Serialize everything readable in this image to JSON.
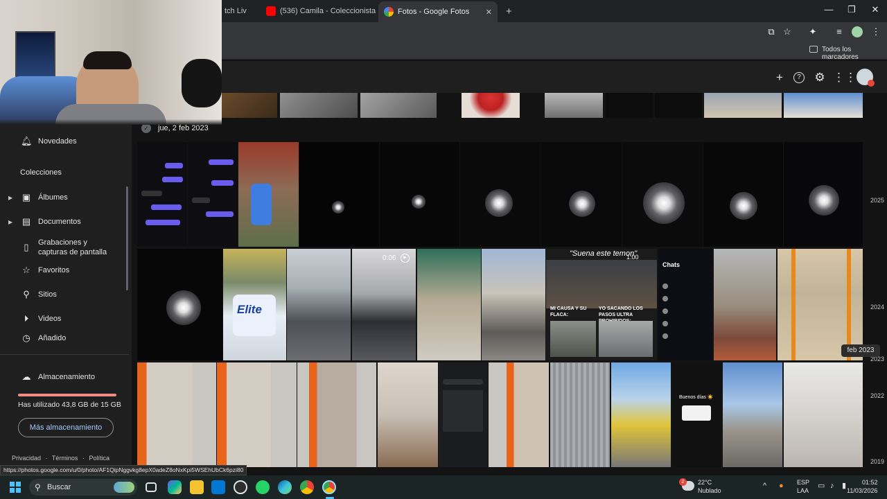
{
  "browser": {
    "tabs": [
      {
        "label": "tch Liv"
      },
      {
        "label": "(536) Camila - Coleccionista"
      },
      {
        "label": "Fotos - Google Fotos"
      }
    ],
    "new_tab_glyph": "+",
    "bookmarks_label": "Todos los marcadores"
  },
  "sidebar": {
    "items_top": [
      {
        "label": "Novedades",
        "icon": "bell-icon"
      }
    ],
    "collections_label": "Colecciones",
    "items": [
      {
        "label": "Álbumes",
        "icon": "album-icon"
      },
      {
        "label": "Documentos",
        "icon": "document-icon"
      },
      {
        "label": "Grabaciones y capturas de pantalla",
        "icon": "phone-icon"
      },
      {
        "label": "Favoritos",
        "icon": "star-icon"
      },
      {
        "label": "Sitios",
        "icon": "location-pin-icon"
      },
      {
        "label": "Videos",
        "icon": "play-circle-icon"
      },
      {
        "label": "Añadido",
        "icon": "clock-icon"
      }
    ],
    "storage": {
      "label": "Almacenamiento",
      "usage_text": "Has utilizado 43,8 GB de 15 GB",
      "fill_fraction": 1.0,
      "fill_color": "#f28b82",
      "button_label": "Más almacenamiento"
    },
    "footer": {
      "privacy": "Privacidad",
      "sep": "·",
      "terms": "Términos",
      "policy": "Política"
    }
  },
  "main": {
    "date_group": "jue, 2 feb 2023",
    "video_duration": "0:06",
    "meme_caption_top": "\"Suena este temon\"",
    "meme_caption_left": "MI CAUSA Y SU FLACA:",
    "meme_caption_right": "YO SACANDO LOS PASOS ULTRA PROHIBIDOS:",
    "meme_time": "1:00",
    "chats_label": "Chats",
    "phone_greeting": "Buenos días ☀️",
    "toilet_paper_brand": "Elite",
    "scrubber": {
      "years": [
        "2025",
        "2024",
        "2023",
        "2022",
        "2019"
      ],
      "current": "feb 2023"
    }
  },
  "status_url": "https://photos.google.com/u/0/photo/AF1QipNggvkg8epX0adeZ8oNxKpi5WSEhUbCk6pzi80",
  "taskbar": {
    "search_label": "Buscar",
    "weather_temp": "22°C",
    "weather_desc": "Nublado",
    "weather_badge": "2",
    "lang_top": "ESP",
    "lang_bottom": "LAA",
    "time": "01:52",
    "date": "11/03/2026"
  },
  "colors": {
    "accent_blue": "#a8c7fa",
    "storage_warning": "#f28b82",
    "taskbar_bg": "#1c2526"
  }
}
